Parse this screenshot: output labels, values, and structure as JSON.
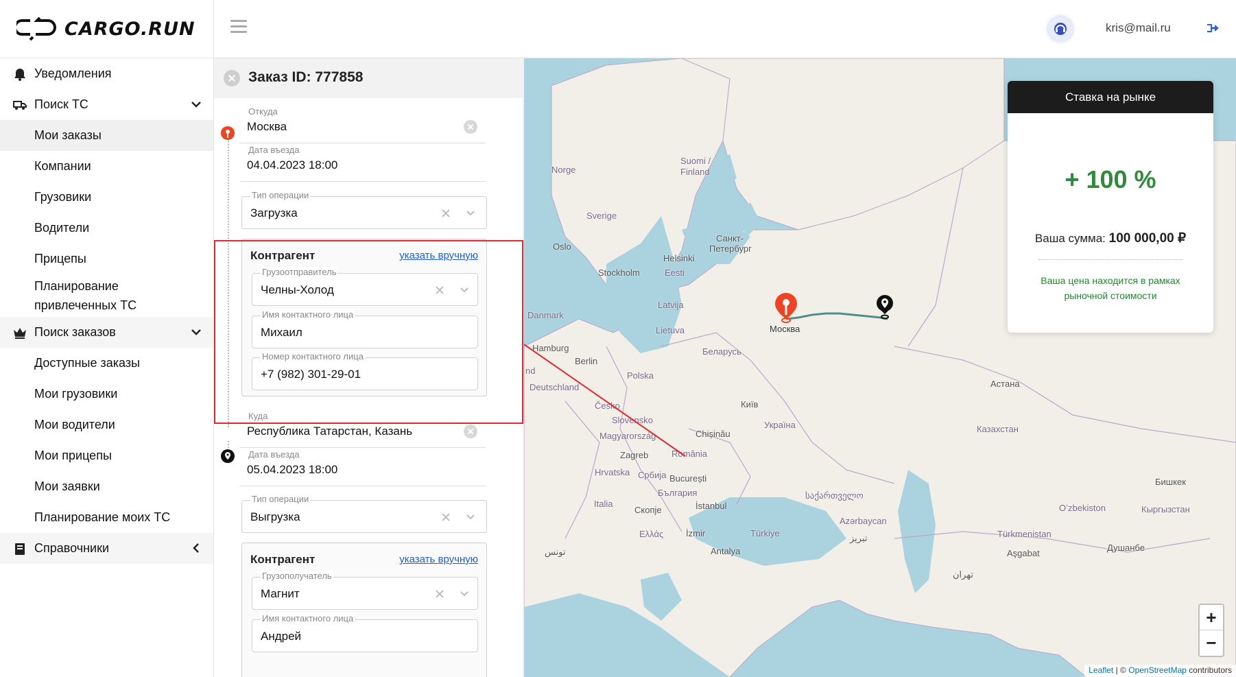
{
  "header": {
    "logo_text": "CARGO.RUN",
    "user_email": "kris@mail.ru"
  },
  "sidebar": {
    "items": [
      {
        "label": "Уведомления",
        "icon": "bell-icon"
      },
      {
        "label": "Поиск ТС",
        "icon": "truck-icon"
      },
      {
        "label": "Мои заказы"
      },
      {
        "label": "Компании"
      },
      {
        "label": "Грузовики"
      },
      {
        "label": "Водители"
      },
      {
        "label": "Прицепы"
      },
      {
        "label": "Планирование привлеченных ТС"
      },
      {
        "label": "Поиск заказов",
        "icon": "crown-icon"
      },
      {
        "label": "Доступные заказы"
      },
      {
        "label": "Мои грузовики"
      },
      {
        "label": "Мои водители"
      },
      {
        "label": "Мои прицепы"
      },
      {
        "label": "Мои заявки"
      },
      {
        "label": "Планирование моих ТС"
      },
      {
        "label": "Справочники",
        "icon": "book-icon"
      }
    ]
  },
  "order": {
    "title": "Заказ ID: 777858",
    "from": {
      "label": "Откуда",
      "value": "Москва",
      "date_label": "Дата въезда",
      "date_value": "04.04.2023 18:00",
      "op_label": "Тип операции",
      "op_value": "Загрузка",
      "counterparty": {
        "title": "Контрагент",
        "manual_link": "указать вручную",
        "party_label": "Грузоотправитель",
        "party_value": "Челны-Холод",
        "contact_label": "Имя контактного лица",
        "contact_value": "Михаил",
        "phone_label": "Номер контактного лица",
        "phone_value": "+7 (982) 301-29-01"
      }
    },
    "to": {
      "label": "Куда",
      "value": "Республика Татарстан, Казань",
      "date_label": "Дата въезда",
      "date_value": "05.04.2023 18:00",
      "op_label": "Тип операции",
      "op_value": "Выгрузка",
      "counterparty": {
        "title": "Контрагент",
        "manual_link": "указать вручную",
        "party_label": "Грузополучатель",
        "party_value": "Магнит",
        "contact_label": "Имя контактного лица",
        "contact_value": "Андрей"
      }
    }
  },
  "market": {
    "title": "Ставка на рынке",
    "percent": "+ 100 %",
    "sum_label": "Ваша сумма:",
    "sum_value": "100 000,00 ₽",
    "note": "Ваша цена находится в рамках рыночной стоимости"
  },
  "map": {
    "labels": [
      {
        "text": "Norge",
        "kind": "country"
      },
      {
        "text": "Suomi /",
        "kind": "country"
      },
      {
        "text": "Finland",
        "kind": "country"
      },
      {
        "text": "Sverige",
        "kind": "country"
      },
      {
        "text": "Oslo",
        "kind": "city"
      },
      {
        "text": "Stockholm",
        "kind": "city"
      },
      {
        "text": "Helsinki",
        "kind": "city"
      },
      {
        "text": "Санкт-",
        "kind": "city"
      },
      {
        "text": "Петербург",
        "kind": "city"
      },
      {
        "text": "Eesti",
        "kind": "country"
      },
      {
        "text": "Latvija",
        "kind": "country"
      },
      {
        "text": "Lietuva",
        "kind": "country"
      },
      {
        "text": "Danmark",
        "kind": "country"
      },
      {
        "text": "Hamburg",
        "kind": "city"
      },
      {
        "text": "Berlin",
        "kind": "city"
      },
      {
        "text": "Polska",
        "kind": "country"
      },
      {
        "text": "Беларусь",
        "kind": "country"
      },
      {
        "text": "Deutschland",
        "kind": "country"
      },
      {
        "text": "Česko",
        "kind": "country"
      },
      {
        "text": "Slovensko",
        "kind": "country"
      },
      {
        "text": "Magyarország",
        "kind": "country"
      },
      {
        "text": "Київ",
        "kind": "city"
      },
      {
        "text": "Україна",
        "kind": "country"
      },
      {
        "text": "Chișinău",
        "kind": "city"
      },
      {
        "text": "Zagreb",
        "kind": "city"
      },
      {
        "text": "România",
        "kind": "country"
      },
      {
        "text": "Hrvatska",
        "kind": "country"
      },
      {
        "text": "Србија",
        "kind": "country"
      },
      {
        "text": "București",
        "kind": "city"
      },
      {
        "text": "България",
        "kind": "country"
      },
      {
        "text": "Italia",
        "kind": "country"
      },
      {
        "text": "Скопје",
        "kind": "city"
      },
      {
        "text": "İstanbul",
        "kind": "city"
      },
      {
        "text": "საქართველო",
        "kind": "country"
      },
      {
        "text": "Azərbaycan",
        "kind": "country"
      },
      {
        "text": "Ελλάς",
        "kind": "country"
      },
      {
        "text": "İzmir",
        "kind": "city"
      },
      {
        "text": "Türkiye",
        "kind": "country"
      },
      {
        "text": "Antalya",
        "kind": "city"
      },
      {
        "text": "تونس",
        "kind": "city"
      },
      {
        "text": "تبریز",
        "kind": "city"
      },
      {
        "text": "Москва",
        "kind": "city"
      },
      {
        "text": "Астана",
        "kind": "city"
      },
      {
        "text": "Казахстан",
        "kind": "country"
      },
      {
        "text": "Бишкек",
        "kind": "city"
      },
      {
        "text": "Oʻzbekiston",
        "kind": "country"
      },
      {
        "text": "Кыргызстан",
        "kind": "country"
      },
      {
        "text": "Türkmenistan",
        "kind": "country"
      },
      {
        "text": "Aşgabat",
        "kind": "city"
      },
      {
        "text": "Душанбе",
        "kind": "city"
      },
      {
        "text": "تهران",
        "kind": "city"
      },
      {
        "text": "nd",
        "kind": "country"
      }
    ],
    "zoom_in": "+",
    "zoom_out": "−",
    "attribution": {
      "leaflet": "Leaflet",
      "sep": "| ©",
      "osm": "OpenStreetMap",
      "contributors": "contributors"
    }
  }
}
